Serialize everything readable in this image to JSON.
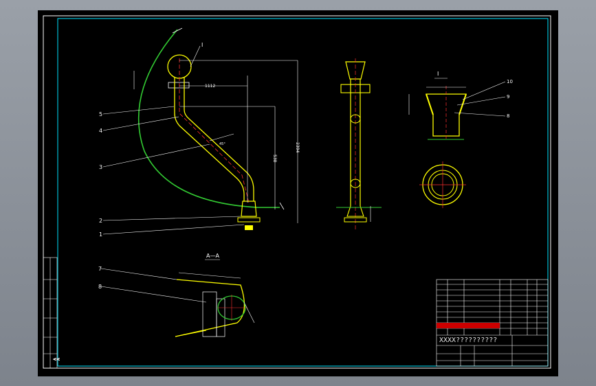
{
  "drawing": {
    "colors": {
      "background": "#000000",
      "frame": "#ffffff",
      "inner_frame": "#00e5ff",
      "part": "#ffff00",
      "centerline": "#ff3030",
      "arc": "#33cc33",
      "dimension": "#ffffff"
    },
    "leaders": [
      "5",
      "4",
      "3",
      "2",
      "1",
      "7",
      "8"
    ],
    "detail_marker": "I",
    "detail_label": "I",
    "section_label": "A—A",
    "callouts_right": [
      "10",
      "9",
      "8"
    ],
    "title_block": {
      "label": "XXXX??????????"
    }
  }
}
